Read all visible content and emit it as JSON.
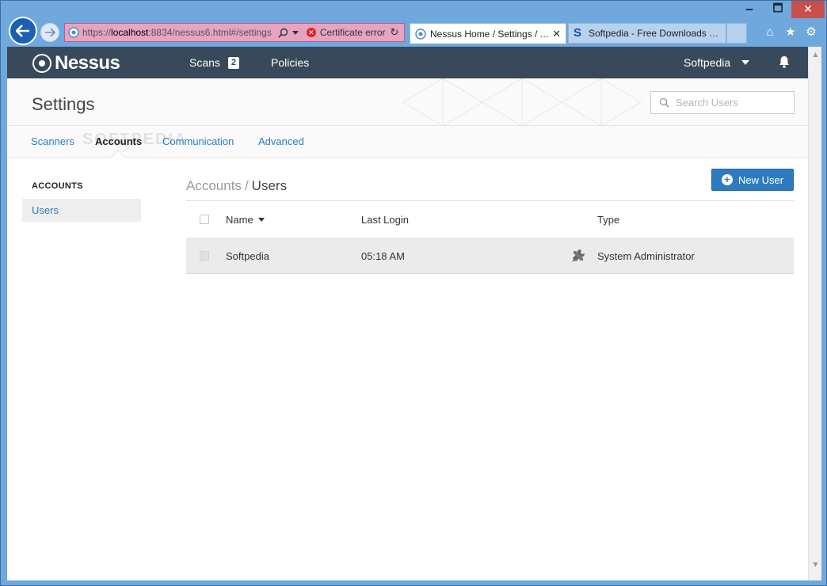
{
  "browser": {
    "address": {
      "url_prefix": "https://",
      "url_host": "localhost",
      "url_rest": ":8834/nessus6.html#/settings",
      "cert_error": "Certificate error"
    },
    "tabs": [
      {
        "title": "Nessus Home / Settings / A..."
      },
      {
        "title": "Softpedia - Free Downloads En..."
      }
    ],
    "window_controls": {
      "minimize": "🗕",
      "maximize": "🗖",
      "close": "✕"
    }
  },
  "header": {
    "logo_text": "Nessus",
    "nav": {
      "scans_label": "Scans",
      "scans_count": "2",
      "policies_label": "Policies"
    },
    "user_name": "Softpedia"
  },
  "page": {
    "title": "Settings",
    "search_placeholder": "Search Users",
    "watermark": "SOFTPEDIA"
  },
  "subtabs": [
    "Scanners",
    "Accounts",
    "Communication",
    "Advanced"
  ],
  "sidebar": {
    "heading": "ACCOUNTS",
    "items": [
      {
        "label": "Users"
      }
    ]
  },
  "content": {
    "breadcrumb_parent": "Accounts",
    "breadcrumb_sep": "/",
    "breadcrumb_current": "Users",
    "new_user_label": "New User",
    "columns": {
      "name": "Name",
      "last_login": "Last Login",
      "type": "Type"
    },
    "rows": [
      {
        "name": "Softpedia",
        "last_login": "05:18 AM",
        "type": "System Administrator"
      }
    ]
  },
  "colors": {
    "header_bg": "#37495a",
    "accent": "#2e7bbf",
    "link": "#2f7abf"
  }
}
